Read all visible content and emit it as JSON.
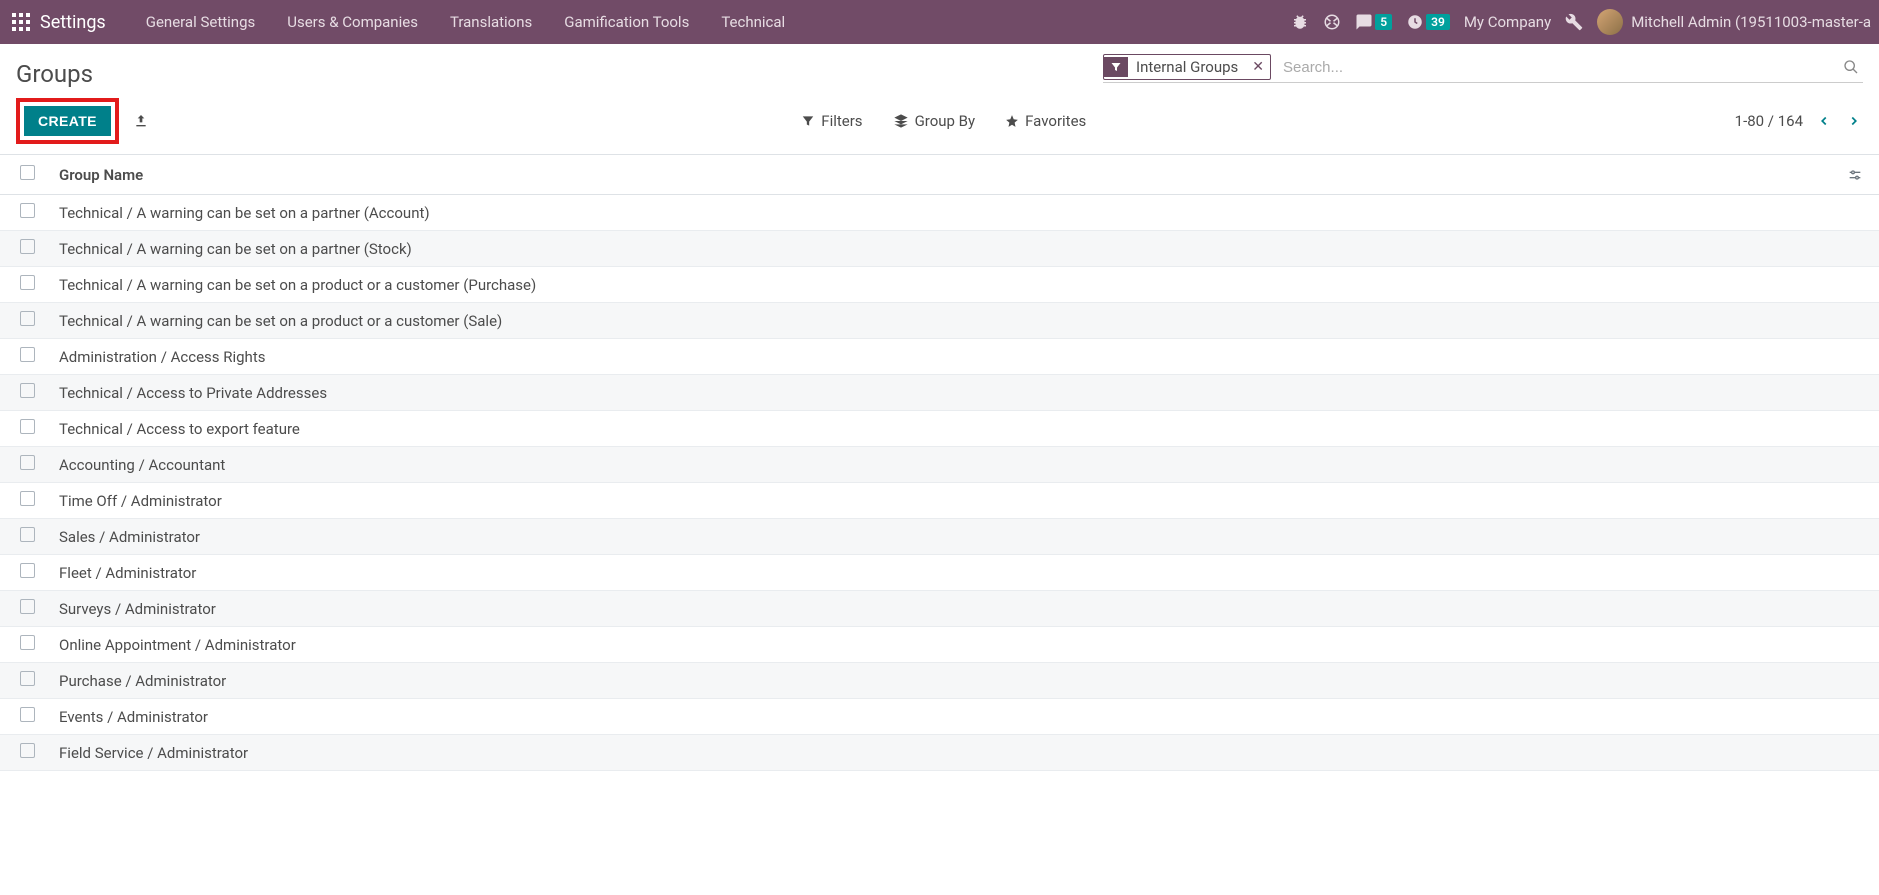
{
  "topbar": {
    "brand": "Settings",
    "menu": [
      "General Settings",
      "Users & Companies",
      "Translations",
      "Gamification Tools",
      "Technical"
    ],
    "messages_count": "5",
    "activities_count": "39",
    "company": "My Company",
    "user_name": "Mitchell Admin (19511003-master-a"
  },
  "control": {
    "breadcrumb": "Groups",
    "create_label": "CREATE",
    "search_facet": "Internal Groups",
    "search_placeholder": "Search...",
    "filters_label": "Filters",
    "groupby_label": "Group By",
    "favorites_label": "Favorites",
    "pager": "1-80 / 164"
  },
  "table": {
    "header": "Group Name",
    "rows": [
      "Technical / A warning can be set on a partner (Account)",
      "Technical / A warning can be set on a partner (Stock)",
      "Technical / A warning can be set on a product or a customer (Purchase)",
      "Technical / A warning can be set on a product or a customer (Sale)",
      "Administration / Access Rights",
      "Technical / Access to Private Addresses",
      "Technical / Access to export feature",
      "Accounting / Accountant",
      "Time Off / Administrator",
      "Sales / Administrator",
      "Fleet / Administrator",
      "Surveys / Administrator",
      "Online Appointment / Administrator",
      "Purchase / Administrator",
      "Events / Administrator",
      "Field Service / Administrator"
    ]
  }
}
